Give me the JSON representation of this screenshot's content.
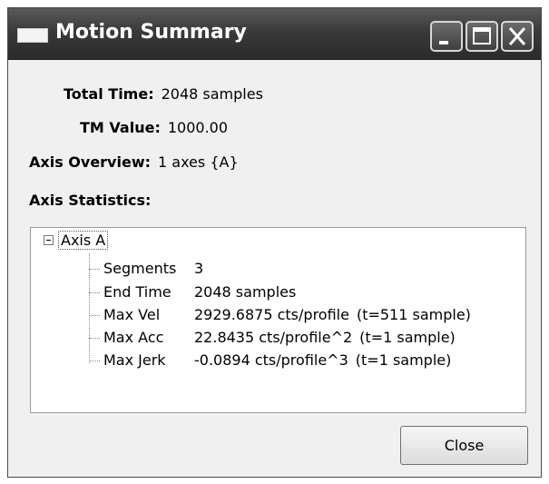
{
  "window": {
    "title": "Motion Summary"
  },
  "summary": {
    "total_time_label": "Total Time:",
    "total_time_value": "2048 samples",
    "tm_label": "TM Value:",
    "tm_value": "1000.00",
    "axis_overview_label": "Axis Overview:",
    "axis_overview_value": "1 axes {A}",
    "axis_statistics_label": "Axis Statistics:"
  },
  "tree": {
    "root_label": "Axis A",
    "children": [
      {
        "name": "Segments",
        "value": "3",
        "note": ""
      },
      {
        "name": "End Time",
        "value": "2048 samples",
        "note": ""
      },
      {
        "name": "Max Vel",
        "value": "2929.6875 cts/profile",
        "note": "(t=511 sample)"
      },
      {
        "name": "Max Acc",
        "value": "22.8435 cts/profile^2",
        "note": "(t=1 sample)"
      },
      {
        "name": "Max Jerk",
        "value": "-0.0894 cts/profile^3",
        "note": "(t=1 sample)"
      }
    ]
  },
  "buttons": {
    "close_label": "Close"
  },
  "icons": {
    "window": "window-icon",
    "minimize": "minimize-icon",
    "maximize": "maximize-icon",
    "close": "close-icon",
    "collapse": "collapse-icon"
  }
}
